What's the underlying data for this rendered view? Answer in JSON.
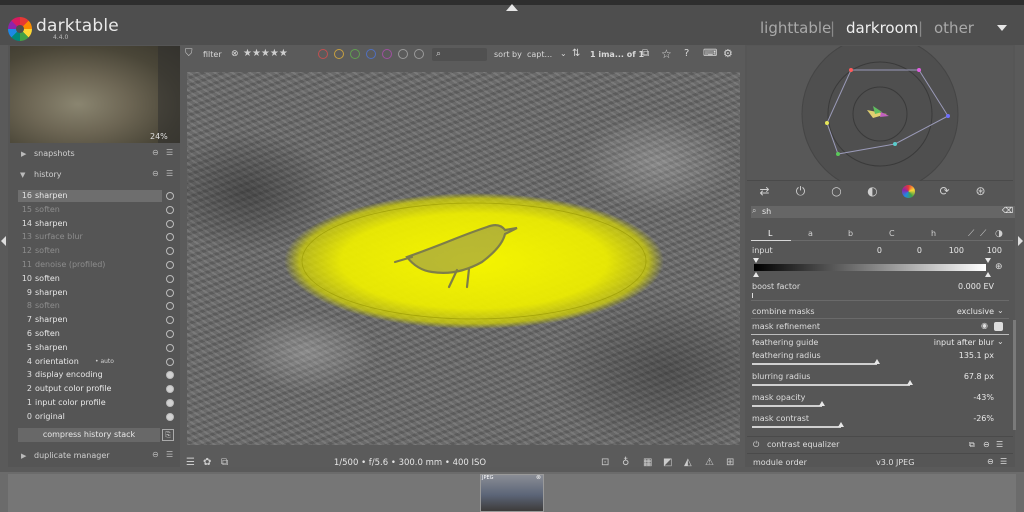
{
  "app": {
    "name": "darktable",
    "version": "4.4.0"
  },
  "views": {
    "lighttable": "lighttable",
    "darkroom": "darkroom",
    "other": "other",
    "sep": "|"
  },
  "navigation": {
    "zoom": "24%"
  },
  "left": {
    "snapshots": "snapshots",
    "history": "history",
    "history_items": [
      {
        "num": "16",
        "name": "sharpen",
        "enabled": true,
        "selected": true
      },
      {
        "num": "15",
        "name": "soften",
        "enabled": false
      },
      {
        "num": "14",
        "name": "sharpen",
        "enabled": true
      },
      {
        "num": "13",
        "name": "surface blur",
        "enabled": false
      },
      {
        "num": "12",
        "name": "soften",
        "enabled": false
      },
      {
        "num": "11",
        "name": "denoise (profiled)",
        "enabled": false
      },
      {
        "num": "10",
        "name": "soften",
        "enabled": true
      },
      {
        "num": "9",
        "name": "sharpen",
        "enabled": true
      },
      {
        "num": "8",
        "name": "soften",
        "enabled": false
      },
      {
        "num": "7",
        "name": "sharpen",
        "enabled": true
      },
      {
        "num": "6",
        "name": "soften",
        "enabled": true
      },
      {
        "num": "5",
        "name": "sharpen",
        "enabled": true
      },
      {
        "num": "4",
        "name": "orientation",
        "enabled": true,
        "auto": "• auto"
      },
      {
        "num": "3",
        "name": "display encoding",
        "enabled": true
      },
      {
        "num": "2",
        "name": "output color profile",
        "enabled": true
      },
      {
        "num": "1",
        "name": "input color profile",
        "enabled": true
      },
      {
        "num": "0",
        "name": "original",
        "enabled": true
      }
    ],
    "compress": "compress history stack",
    "duplicate_manager": "duplicate manager"
  },
  "toolbar": {
    "filter": "filter",
    "stars": "★★★★★",
    "sort_by": "sort by",
    "sort_value": "capt...",
    "count": "1 ima... of 1",
    "color_labels": [
      "#c05050",
      "#c8a040",
      "#60a050",
      "#5070c0",
      "#a050a0"
    ]
  },
  "image_info": "1/500 • f/5.6 • 300.0 mm • 400 ISO",
  "module": {
    "search": "sh",
    "tabs": [
      "L",
      "a",
      "b",
      "C",
      "h"
    ],
    "input_label": "input",
    "input_values": [
      "0",
      "0",
      "100",
      "100"
    ],
    "boost_factor": {
      "label": "boost factor",
      "value": "0.000 EV"
    },
    "combine_masks": {
      "label": "combine masks",
      "value": "exclusive"
    },
    "mask_refinement": "mask refinement",
    "feathering_guide": {
      "label": "feathering guide",
      "value": "input after blur"
    },
    "feathering_radius": {
      "label": "feathering radius",
      "value": "135.1 px",
      "level": 0.52
    },
    "blurring_radius": {
      "label": "blurring radius",
      "value": "67.8 px",
      "level": 0.66
    },
    "mask_opacity": {
      "label": "mask opacity",
      "value": "-43%",
      "level": 0.29
    },
    "mask_contrast": {
      "label": "mask contrast",
      "value": "-26%",
      "level": 0.37
    },
    "contrast_equalizer": "contrast equalizer",
    "module_order": {
      "label": "module order",
      "value": "v3.0 JPEG"
    }
  },
  "filmstrip": {
    "badge": "JPEG"
  },
  "colors": {
    "mask": "#f2f200",
    "accent": "#d8d8d8"
  }
}
